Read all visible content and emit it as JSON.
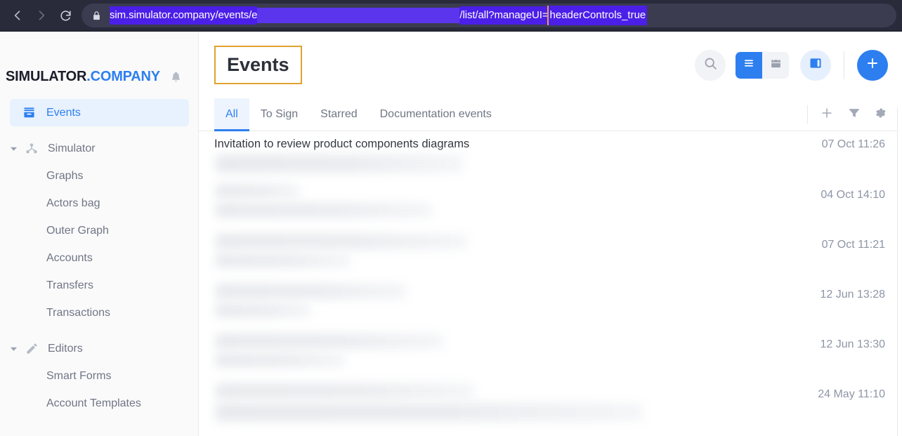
{
  "browser": {
    "back_icon": "back-arrow-icon",
    "forward_icon": "forward-arrow-icon",
    "reload_icon": "reload-icon",
    "lock_icon": "lock-icon",
    "url_prefix": "sim.simulator.company/events/e",
    "url_redacted": "",
    "url_suffix": "/list/all?manageUI=",
    "url_highlighted_param": "headerControls_true",
    "highlight_color": "#e8a33d",
    "url_selection_color": "#4b1fe8"
  },
  "sidebar": {
    "brand_main": "SIMULATOR",
    "brand_accent": ".COMPANY",
    "bell_icon": "notification-bell-icon",
    "items": [
      {
        "label": "Events",
        "icon": "inbox-icon",
        "level": "top",
        "active": true,
        "caret": false
      },
      {
        "label": "Simulator",
        "icon": "share-nodes-icon",
        "level": "group",
        "active": false,
        "caret": true
      },
      {
        "label": "Graphs",
        "icon": "",
        "level": "child",
        "active": false,
        "caret": false
      },
      {
        "label": "Actors bag",
        "icon": "",
        "level": "child",
        "active": false,
        "caret": false
      },
      {
        "label": "Outer Graph",
        "icon": "",
        "level": "child",
        "active": false,
        "caret": false
      },
      {
        "label": "Accounts",
        "icon": "",
        "level": "child",
        "active": false,
        "caret": false
      },
      {
        "label": "Transfers",
        "icon": "",
        "level": "child",
        "active": false,
        "caret": false
      },
      {
        "label": "Transactions",
        "icon": "",
        "level": "child",
        "active": false,
        "caret": false
      },
      {
        "label": "Editors",
        "icon": "pencil-icon",
        "level": "group",
        "active": false,
        "caret": true
      },
      {
        "label": "Smart Forms",
        "icon": "",
        "level": "child",
        "active": false,
        "caret": false
      },
      {
        "label": "Account Templates",
        "icon": "",
        "level": "child",
        "active": false,
        "caret": false
      }
    ]
  },
  "header": {
    "title": "Events",
    "title_highlight_color": "#e0a22e",
    "search_icon": "search-icon",
    "view_list_icon": "list-view-icon",
    "view_calendar_icon": "calendar-view-icon",
    "panel_toggle_icon": "side-panel-toggle-icon",
    "add_icon": "plus-icon",
    "accent_color": "#2d7ff0"
  },
  "tabs": {
    "items": [
      {
        "label": "All",
        "active": true
      },
      {
        "label": "To Sign",
        "active": false
      },
      {
        "label": "Starred",
        "active": false
      },
      {
        "label": "Documentation events",
        "active": false
      }
    ],
    "tools": [
      {
        "icon": "plus-icon",
        "name": "add-event-button"
      },
      {
        "icon": "filter-funnel-icon",
        "name": "filter-button"
      },
      {
        "icon": "gear-icon",
        "name": "settings-button"
      }
    ]
  },
  "events": [
    {
      "title": "Invitation to review product components diagrams",
      "date": "07 Oct 11:26",
      "redacted": false
    },
    {
      "title": "",
      "date": "04 Oct 14:10",
      "redacted": true
    },
    {
      "title": "",
      "date": "07 Oct 11:21",
      "redacted": true
    },
    {
      "title": "",
      "date": "12 Jun 13:28",
      "redacted": true
    },
    {
      "title": "",
      "date": "12 Jun 13:30",
      "redacted": true
    },
    {
      "title": "",
      "date": "24 May 11:10",
      "redacted": true
    }
  ]
}
